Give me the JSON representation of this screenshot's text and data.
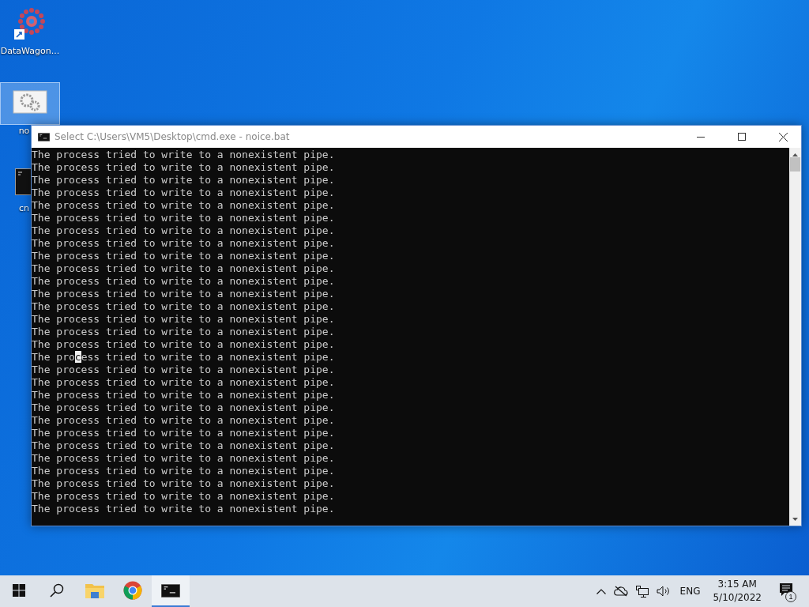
{
  "desktop_icons": [
    {
      "kind": "datawagon",
      "label": "DataWagon...",
      "selected": false
    },
    {
      "kind": "batch",
      "label": "no",
      "selected": true
    },
    {
      "kind": "console",
      "label": "cn",
      "selected": false
    }
  ],
  "window": {
    "title": "Select C:\\Users\\VM5\\Desktop\\cmd.exe - noice.bat"
  },
  "console_lines": [
    {
      "kind": "plain",
      "text": "The process tried to write to a nonexistent pipe."
    },
    {
      "kind": "plain",
      "text": "The process tried to write to a nonexistent pipe."
    },
    {
      "kind": "plain",
      "text": "The process tried to write to a nonexistent pipe."
    },
    {
      "kind": "plain",
      "text": "The process tried to write to a nonexistent pipe."
    },
    {
      "kind": "plain",
      "text": "The process tried to write to a nonexistent pipe."
    },
    {
      "kind": "plain",
      "text": "The process tried to write to a nonexistent pipe."
    },
    {
      "kind": "plain",
      "text": "The process tried to write to a nonexistent pipe."
    },
    {
      "kind": "plain",
      "text": "The process tried to write to a nonexistent pipe."
    },
    {
      "kind": "plain",
      "text": "The process tried to write to a nonexistent pipe."
    },
    {
      "kind": "plain",
      "text": "The process tried to write to a nonexistent pipe."
    },
    {
      "kind": "plain",
      "text": "The process tried to write to a nonexistent pipe."
    },
    {
      "kind": "plain",
      "text": "The process tried to write to a nonexistent pipe."
    },
    {
      "kind": "plain",
      "text": "The process tried to write to a nonexistent pipe."
    },
    {
      "kind": "plain",
      "text": "The process tried to write to a nonexistent pipe."
    },
    {
      "kind": "plain",
      "text": "The process tried to write to a nonexistent pipe."
    },
    {
      "kind": "plain",
      "text": "The process tried to write to a nonexistent pipe."
    },
    {
      "kind": "cursor",
      "before": "The pro",
      "cursor": "c",
      "after": "ess tried to write to a nonexistent pipe."
    },
    {
      "kind": "plain",
      "text": "The process tried to write to a nonexistent pipe."
    },
    {
      "kind": "plain",
      "text": "The process tried to write to a nonexistent pipe."
    },
    {
      "kind": "plain",
      "text": "The process tried to write to a nonexistent pipe."
    },
    {
      "kind": "plain",
      "text": "The process tried to write to a nonexistent pipe."
    },
    {
      "kind": "plain",
      "text": "The process tried to write to a nonexistent pipe."
    },
    {
      "kind": "plain",
      "text": "The process tried to write to a nonexistent pipe."
    },
    {
      "kind": "plain",
      "text": "The process tried to write to a nonexistent pipe."
    },
    {
      "kind": "plain",
      "text": "The process tried to write to a nonexistent pipe."
    },
    {
      "kind": "plain",
      "text": "The process tried to write to a nonexistent pipe."
    },
    {
      "kind": "plain",
      "text": "The process tried to write to a nonexistent pipe."
    },
    {
      "kind": "plain",
      "text": "The process tried to write to a nonexistent pipe."
    },
    {
      "kind": "plain",
      "text": "The process tried to write to a nonexistent pipe."
    }
  ],
  "taskbar": {
    "apps": [
      {
        "kind": "start",
        "selected": false
      },
      {
        "kind": "search",
        "selected": false
      },
      {
        "kind": "explorer",
        "selected": false
      },
      {
        "kind": "chrome",
        "selected": false
      },
      {
        "kind": "console",
        "selected": true
      }
    ],
    "tray": {
      "language": "ENG",
      "time": "3:15 AM",
      "date": "5/10/2022",
      "notification_count": "1"
    }
  }
}
